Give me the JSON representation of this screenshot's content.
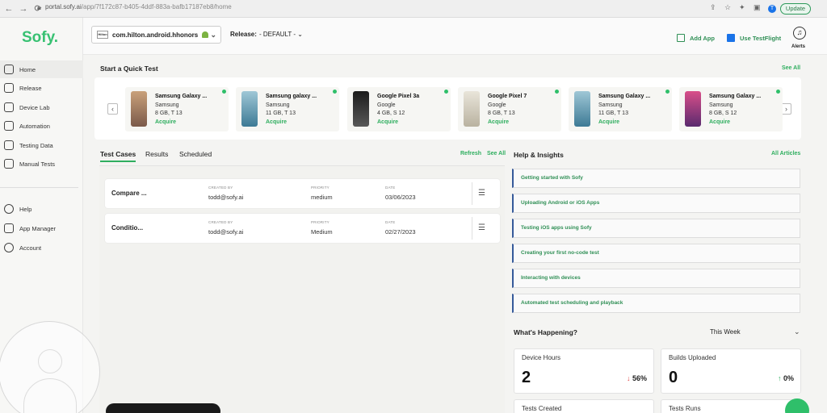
{
  "browser": {
    "url_prefix": "portal.sofy.ai",
    "url_path": "/app/7f172c87-b405-4ddf-883a-bafb17187eb8/home",
    "profile_initial": "T",
    "update_label": "Update"
  },
  "sidebar": {
    "logo": "Sofy.",
    "items": [
      {
        "label": "Home",
        "icon": "home-icon"
      },
      {
        "label": "Release",
        "icon": "rocket-icon"
      },
      {
        "label": "Device Lab",
        "icon": "monitor-icon"
      },
      {
        "label": "Automation",
        "icon": "automation-icon"
      },
      {
        "label": "Testing Data",
        "icon": "data-icon"
      },
      {
        "label": "Manual Tests",
        "icon": "checklist-icon"
      },
      {
        "label": "Help",
        "icon": "help-icon"
      },
      {
        "label": "App Manager",
        "icon": "grid-icon"
      },
      {
        "label": "Account",
        "icon": "user-circle-icon"
      }
    ]
  },
  "topbar": {
    "app_name": "com.hilton.android.hhonors",
    "app_thumb": "Hilton",
    "release_label": "Release:",
    "release_value": "- DEFAULT -",
    "add_app": "Add App",
    "testflight": "Use TestFlight",
    "alerts": "Alerts"
  },
  "quick_test": {
    "title": "Start a Quick Test",
    "see_all": "See All",
    "devices": [
      {
        "name": "Samsung Galaxy ...",
        "maker": "Samsung",
        "spec": "8 GB, T 13",
        "action": "Acquire"
      },
      {
        "name": "Samsung galaxy ...",
        "maker": "Samsung",
        "spec": "11 GB, T 13",
        "action": "Acquire"
      },
      {
        "name": "Google Pixel 3a",
        "maker": "Google",
        "spec": "4 GB, S 12",
        "action": "Acquire"
      },
      {
        "name": "Google Pixel 7",
        "maker": "Google",
        "spec": "8 GB, T 13",
        "action": "Acquire"
      },
      {
        "name": "Samsung Galaxy ...",
        "maker": "Samsung",
        "spec": "11 GB, T 13",
        "action": "Acquire"
      },
      {
        "name": "Samsung Galaxy ...",
        "maker": "Samsung",
        "spec": "8 GB, S 12",
        "action": "Acquire"
      }
    ]
  },
  "test_cases": {
    "tabs": [
      "Test Cases",
      "Results",
      "Scheduled"
    ],
    "refresh": "Refresh",
    "see_all": "See All",
    "col_created": "CREATED BY",
    "col_priority": "PRIORITY",
    "col_date": "DATE",
    "rows": [
      {
        "name": "Compare ...",
        "created_by": "todd@sofy.ai",
        "priority": "medium",
        "date": "03/06/2023"
      },
      {
        "name": "Conditio...",
        "created_by": "todd@sofy.ai",
        "priority": "Medium",
        "date": "02/27/2023"
      }
    ]
  },
  "help": {
    "title": "Help & Insights",
    "all_articles": "All Articles",
    "articles": [
      "Getting started with Sofy",
      "Uploading Android or iOS Apps",
      "Testing iOS apps using Sofy",
      "Creating your first no-code test",
      "Interacting with devices",
      "Automated test scheduling and playback"
    ]
  },
  "happening": {
    "title": "What's Happening?",
    "period": "This Week",
    "stats": [
      {
        "label": "Device Hours",
        "value": "2",
        "trend": "56%",
        "direction": "down"
      },
      {
        "label": "Builds Uploaded",
        "value": "0",
        "trend": "0%",
        "direction": "up"
      },
      {
        "label": "Tests Created"
      },
      {
        "label": "Tests Runs"
      }
    ]
  },
  "colors": {
    "brand": "#38c172",
    "link": "#2fae5f",
    "accent_border": "#355a9a"
  }
}
